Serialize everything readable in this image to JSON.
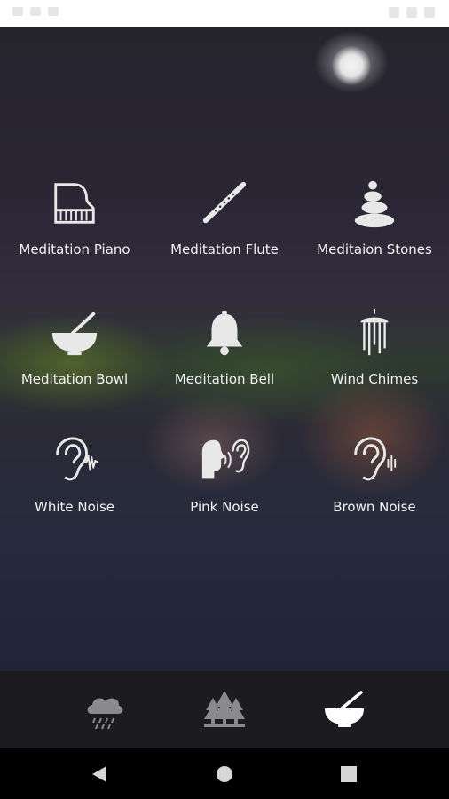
{
  "sounds": [
    {
      "label": "Meditation Piano",
      "icon": "piano-icon"
    },
    {
      "label": "Meditation Flute",
      "icon": "flute-icon"
    },
    {
      "label": "Meditaion Stones",
      "icon": "stones-icon"
    },
    {
      "label": "Meditation Bowl",
      "icon": "singing-bowl-icon"
    },
    {
      "label": "Meditation Bell",
      "icon": "bell-icon"
    },
    {
      "label": "Wind Chimes",
      "icon": "wind-chimes-icon"
    },
    {
      "label": "White Noise",
      "icon": "ear-waveform-icon"
    },
    {
      "label": "Pink Noise",
      "icon": "head-ear-icon"
    },
    {
      "label": "Brown Noise",
      "icon": "ear-sound-icon"
    }
  ],
  "tabs": [
    {
      "icon": "rain-cloud-icon"
    },
    {
      "icon": "forest-icon"
    },
    {
      "icon": "singing-bowl-icon",
      "active": true
    }
  ],
  "navigation": [
    {
      "icon": "back-icon"
    },
    {
      "icon": "home-icon"
    },
    {
      "icon": "recents-icon"
    }
  ],
  "colors": {
    "icon": "#e8e8e8",
    "label": "#f2f2f2",
    "tabbar": "#1c1c20",
    "navbar": "#000000"
  }
}
